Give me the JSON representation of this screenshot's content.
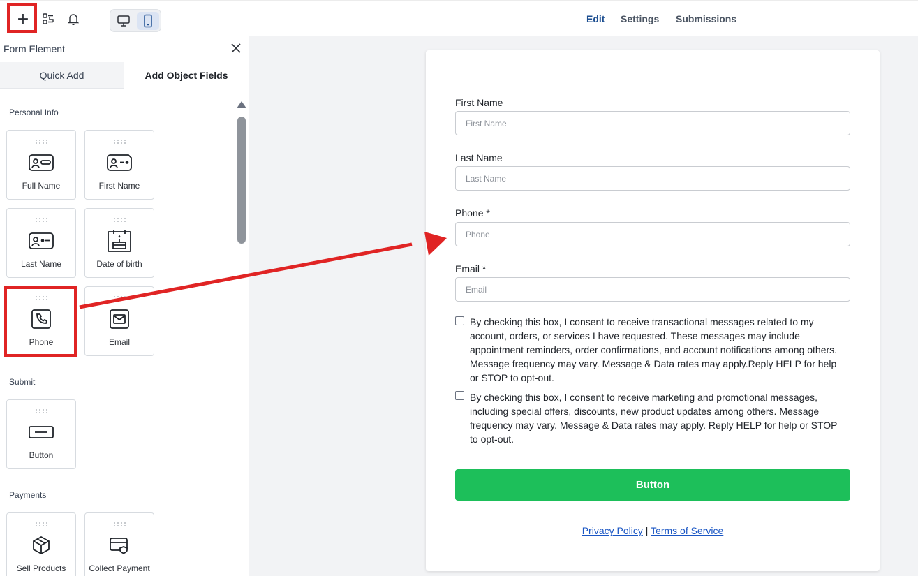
{
  "topbar": {
    "add_label": "+",
    "nav": [
      "Edit",
      "Settings",
      "Submissions"
    ],
    "active_nav": "Edit"
  },
  "sidebar": {
    "title": "Form Element",
    "tabs": [
      "Quick Add",
      "Add Object Fields"
    ],
    "sections": [
      {
        "label": "Personal Info",
        "items": [
          {
            "label": "Full Name",
            "icon": "id-card-icon"
          },
          {
            "label": "First Name",
            "icon": "id-card-icon"
          },
          {
            "label": "Last Name",
            "icon": "id-card-icon"
          },
          {
            "label": "Date of birth",
            "icon": "cake-calendar-icon"
          },
          {
            "label": "Phone",
            "icon": "phone-icon"
          },
          {
            "label": "Email",
            "icon": "mail-icon"
          }
        ]
      },
      {
        "label": "Submit",
        "items": [
          {
            "label": "Button",
            "icon": "button-icon"
          }
        ]
      },
      {
        "label": "Payments",
        "items": [
          {
            "label": "Sell Products",
            "icon": "box-icon"
          },
          {
            "label": "Collect Payment",
            "icon": "card-icon"
          }
        ]
      }
    ]
  },
  "form": {
    "fields": [
      {
        "label": "First Name",
        "placeholder": "First Name"
      },
      {
        "label": "Last Name",
        "placeholder": "Last Name"
      },
      {
        "label": "Phone *",
        "placeholder": "Phone"
      },
      {
        "label": "Email *",
        "placeholder": "Email"
      }
    ],
    "consents": [
      "By checking this box, I consent to receive transactional messages related to my account, orders, or services I have requested. These messages may include appointment reminders, order confirmations, and account notifications among others. Message frequency may vary. Message & Data rates may apply.Reply HELP for help or STOP to opt-out.",
      "By checking this box, I consent to receive marketing and promotional messages, including special offers, discounts, new product updates among others. Message frequency may vary. Message & Data rates may apply. Reply HELP for help or STOP to opt-out."
    ],
    "submit_label": "Button",
    "privacy_label": "Privacy Policy",
    "separator": "|",
    "terms_label": "Terms of Service"
  },
  "colors": {
    "accent_red": "#e02424",
    "submit_green": "#1dbf5a",
    "link_blue": "#1a56c4",
    "nav_active": "#1d4f91"
  }
}
